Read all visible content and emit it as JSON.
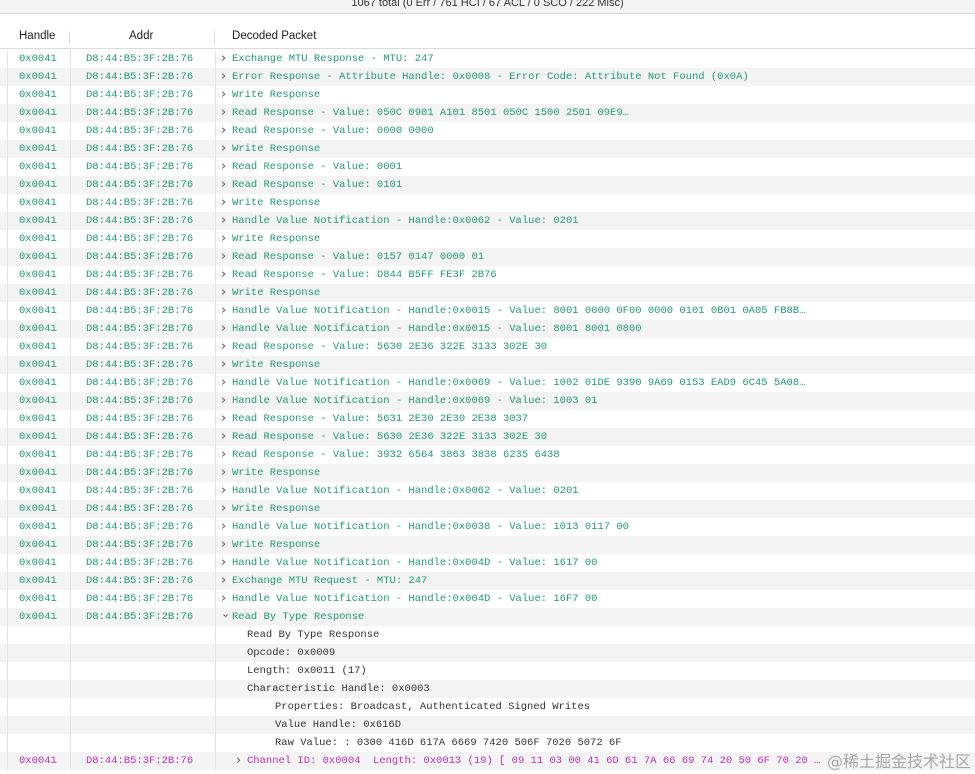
{
  "status": "1067 total (0 Err / 761 HCI / 67 ACL / 0 SCO / 222 Misc)",
  "columns": {
    "handle": "Handle",
    "addr": "Addr",
    "decoded": "Decoded Packet"
  },
  "colors": {
    "green": "#1f9b77",
    "magenta": "#c02fc0",
    "detail": "#333333"
  },
  "rows": [
    {
      "handle": "0x0041",
      "addr": "D8:44:B5:3F:2B:76",
      "text": "Exchange MTU Response - MTU: 247"
    },
    {
      "handle": "0x0041",
      "addr": "D8:44:B5:3F:2B:76",
      "text": "Error Response - Attribute Handle: 0x0008 - Error Code: Attribute Not Found (0x0A)"
    },
    {
      "handle": "0x0041",
      "addr": "D8:44:B5:3F:2B:76",
      "text": "Write Response"
    },
    {
      "handle": "0x0041",
      "addr": "D8:44:B5:3F:2B:76",
      "text": "Read Response - Value: 050C 0901 A101 8501 050C 1500 2501 09E9…"
    },
    {
      "handle": "0x0041",
      "addr": "D8:44:B5:3F:2B:76",
      "text": "Read Response - Value: 0000 0000"
    },
    {
      "handle": "0x0041",
      "addr": "D8:44:B5:3F:2B:76",
      "text": "Write Response"
    },
    {
      "handle": "0x0041",
      "addr": "D8:44:B5:3F:2B:76",
      "text": "Read Response - Value: 0001"
    },
    {
      "handle": "0x0041",
      "addr": "D8:44:B5:3F:2B:76",
      "text": "Read Response - Value: 0101"
    },
    {
      "handle": "0x0041",
      "addr": "D8:44:B5:3F:2B:76",
      "text": "Write Response"
    },
    {
      "handle": "0x0041",
      "addr": "D8:44:B5:3F:2B:76",
      "text": "Handle Value Notification - Handle:0x0062 - Value: 0201"
    },
    {
      "handle": "0x0041",
      "addr": "D8:44:B5:3F:2B:76",
      "text": "Write Response"
    },
    {
      "handle": "0x0041",
      "addr": "D8:44:B5:3F:2B:76",
      "text": "Read Response - Value: 0157 0147 0000 01"
    },
    {
      "handle": "0x0041",
      "addr": "D8:44:B5:3F:2B:76",
      "text": "Read Response - Value: D844 B5FF FE3F 2B76"
    },
    {
      "handle": "0x0041",
      "addr": "D8:44:B5:3F:2B:76",
      "text": "Write Response"
    },
    {
      "handle": "0x0041",
      "addr": "D8:44:B5:3F:2B:76",
      "text": "Handle Value Notification - Handle:0x0015 - Value: 8001 0000 0F00 0000 0101 0B01 0A05 FB8B…"
    },
    {
      "handle": "0x0041",
      "addr": "D8:44:B5:3F:2B:76",
      "text": "Handle Value Notification - Handle:0x0015 - Value: 8001 8001 0800"
    },
    {
      "handle": "0x0041",
      "addr": "D8:44:B5:3F:2B:76",
      "text": "Read Response - Value: 5630 2E36 322E 3133 302E 30"
    },
    {
      "handle": "0x0041",
      "addr": "D8:44:B5:3F:2B:76",
      "text": "Write Response"
    },
    {
      "handle": "0x0041",
      "addr": "D8:44:B5:3F:2B:76",
      "text": "Handle Value Notification - Handle:0x0069 - Value: 1002 01DE 9390 9A69 0153 EAD9 6C45 5A08…"
    },
    {
      "handle": "0x0041",
      "addr": "D8:44:B5:3F:2B:76",
      "text": "Handle Value Notification - Handle:0x0069 - Value: 1003 01"
    },
    {
      "handle": "0x0041",
      "addr": "D8:44:B5:3F:2B:76",
      "text": "Read Response - Value: 5631 2E30 2E30 2E38 3037"
    },
    {
      "handle": "0x0041",
      "addr": "D8:44:B5:3F:2B:76",
      "text": "Read Response - Value: 5630 2E36 322E 3133 302E 30"
    },
    {
      "handle": "0x0041",
      "addr": "D8:44:B5:3F:2B:76",
      "text": "Read Response - Value: 3932 6564 3863 3838 6235 6438"
    },
    {
      "handle": "0x0041",
      "addr": "D8:44:B5:3F:2B:76",
      "text": "Write Response"
    },
    {
      "handle": "0x0041",
      "addr": "D8:44:B5:3F:2B:76",
      "text": "Handle Value Notification - Handle:0x0062 - Value: 0201"
    },
    {
      "handle": "0x0041",
      "addr": "D8:44:B5:3F:2B:76",
      "text": "Write Response"
    },
    {
      "handle": "0x0041",
      "addr": "D8:44:B5:3F:2B:76",
      "text": "Handle Value Notification - Handle:0x0038 - Value: 1013 0117 00"
    },
    {
      "handle": "0x0041",
      "addr": "D8:44:B5:3F:2B:76",
      "text": "Write Response"
    },
    {
      "handle": "0x0041",
      "addr": "D8:44:B5:3F:2B:76",
      "text": "Handle Value Notification - Handle:0x004D - Value: 1617 00"
    },
    {
      "handle": "0x0041",
      "addr": "D8:44:B5:3F:2B:76",
      "text": "Exchange MTU Request - MTU: 247"
    },
    {
      "handle": "0x0041",
      "addr": "D8:44:B5:3F:2B:76",
      "text": "Handle Value Notification - Handle:0x004D - Value: 16F7 00"
    },
    {
      "handle": "0x0041",
      "addr": "D8:44:B5:3F:2B:76",
      "text": "Read By Type Response",
      "expanded": true
    }
  ],
  "details": [
    {
      "text": "Read By Type Response",
      "level": 1
    },
    {
      "text": "Opcode: 0x0009",
      "level": 1
    },
    {
      "text": "Length: 0x0011 (17)",
      "level": 1
    },
    {
      "text": "Characteristic Handle: 0x0003",
      "level": 1
    },
    {
      "text": "Properties: Broadcast, Authenticated Signed Writes",
      "level": 2
    },
    {
      "text": "Value Handle: 0x616D",
      "level": 2
    },
    {
      "text": "Raw Value: : 0300 416D 617A 6669 7420 506F 7020 5072 6F",
      "level": 2
    }
  ],
  "last_row": {
    "handle": "0x0041",
    "addr": "D8:44:B5:3F:2B:76",
    "text": "Channel ID: 0x0004  Length: 0x0013 (19) [ 09 11 03 00 41 6D 61 7A 66 69 74 20 50 6F 70 20 …"
  },
  "watermark": "@稀土掘金技术社区"
}
